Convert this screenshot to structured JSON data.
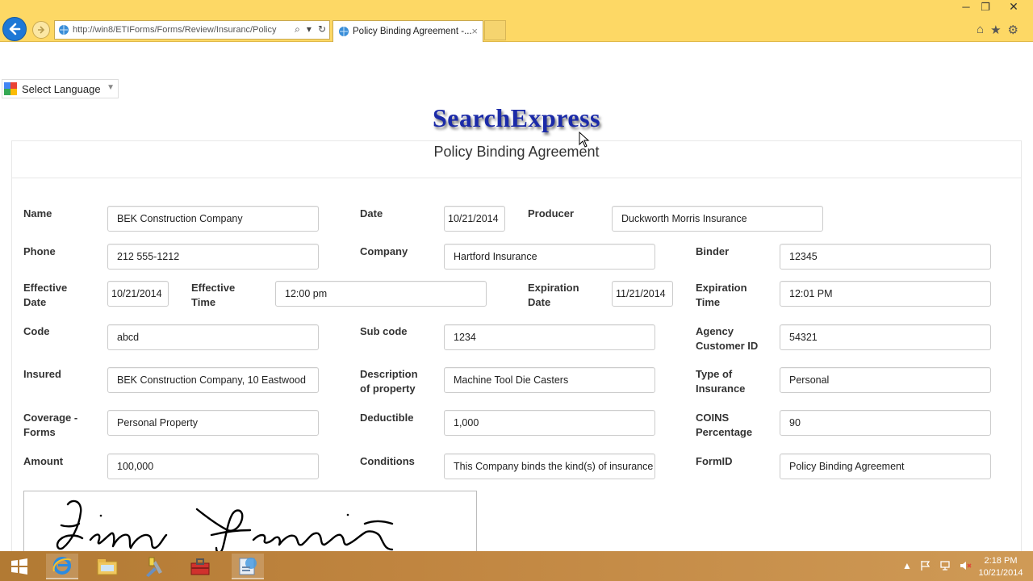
{
  "browser": {
    "url": "http://win8/ETIForms/Forms/Review/Insuranc/Policy",
    "tab_title": "Policy Binding Agreement -...",
    "tab_close": "×",
    "win_min": "─",
    "win_restore": "❐",
    "win_close": "✕",
    "search_glyph": "⌕",
    "dropdown_glyph": "▾",
    "refresh_glyph": "↻",
    "home_icon": "⌂",
    "favorites_icon": "★",
    "settings_icon": "⚙"
  },
  "language": {
    "label": "Select Language",
    "arrow": "▼"
  },
  "logo": "SearchExpress",
  "form": {
    "title": "Policy Binding Agreement",
    "fields": {
      "name": {
        "label": "Name",
        "value": "BEK Construction Company"
      },
      "date": {
        "label": "Date",
        "value": "10/21/2014"
      },
      "producer": {
        "label": "Producer",
        "value": "Duckworth Morris Insurance"
      },
      "phone": {
        "label": "Phone",
        "value": "212 555-1212"
      },
      "company": {
        "label": "Company",
        "value": "Hartford Insurance"
      },
      "binder": {
        "label": "Binder",
        "value": "12345"
      },
      "effective_date": {
        "label_1": "Effective",
        "label_2": "Date",
        "value": "10/21/2014"
      },
      "effective_time": {
        "label_1": "Effective",
        "label_2": "Time",
        "value": "12:00 pm"
      },
      "expiration_date": {
        "label_1": "Expiration",
        "label_2": "Date",
        "value": "11/21/2014"
      },
      "expiration_time": {
        "label_1": "Expiration",
        "label_2": "Time",
        "value": "12:01 PM"
      },
      "code": {
        "label": "Code",
        "value": "abcd"
      },
      "sub_code": {
        "label": "Sub code",
        "value": "1234"
      },
      "agency_customer_id": {
        "label_1": "Agency",
        "label_2": "Customer ID",
        "value": "54321"
      },
      "insured": {
        "label": "Insured",
        "value": "BEK Construction Company, 10 Eastwood"
      },
      "description": {
        "label_1": "Description",
        "label_2": "of property",
        "value": "Machine Tool Die Casters"
      },
      "type_of_insurance": {
        "label_1": "Type of",
        "label_2": "Insurance",
        "value": "Personal"
      },
      "coverage_forms": {
        "label_1": "Coverage -",
        "label_2": "Forms",
        "value": "Personal Property"
      },
      "deductible": {
        "label": "Deductible",
        "value": "1,000"
      },
      "coins_percentage": {
        "label_1": "COINS",
        "label_2": "Percentage",
        "value": "90"
      },
      "amount": {
        "label": "Amount",
        "value": "100,000"
      },
      "conditions": {
        "label": "Conditions",
        "value": "This Company binds the kind(s) of insurance"
      },
      "form_id": {
        "label": "FormID",
        "value": "Policy Binding Agreement"
      }
    }
  },
  "taskbar": {
    "time": "2:18 PM",
    "date": "10/21/2014",
    "tray_arrow": "▲"
  },
  "colors": {
    "chrome": "#fdd865",
    "logo": "#1b2aa8",
    "taskbar": "#c08540",
    "back_button": "#1e78d6"
  }
}
